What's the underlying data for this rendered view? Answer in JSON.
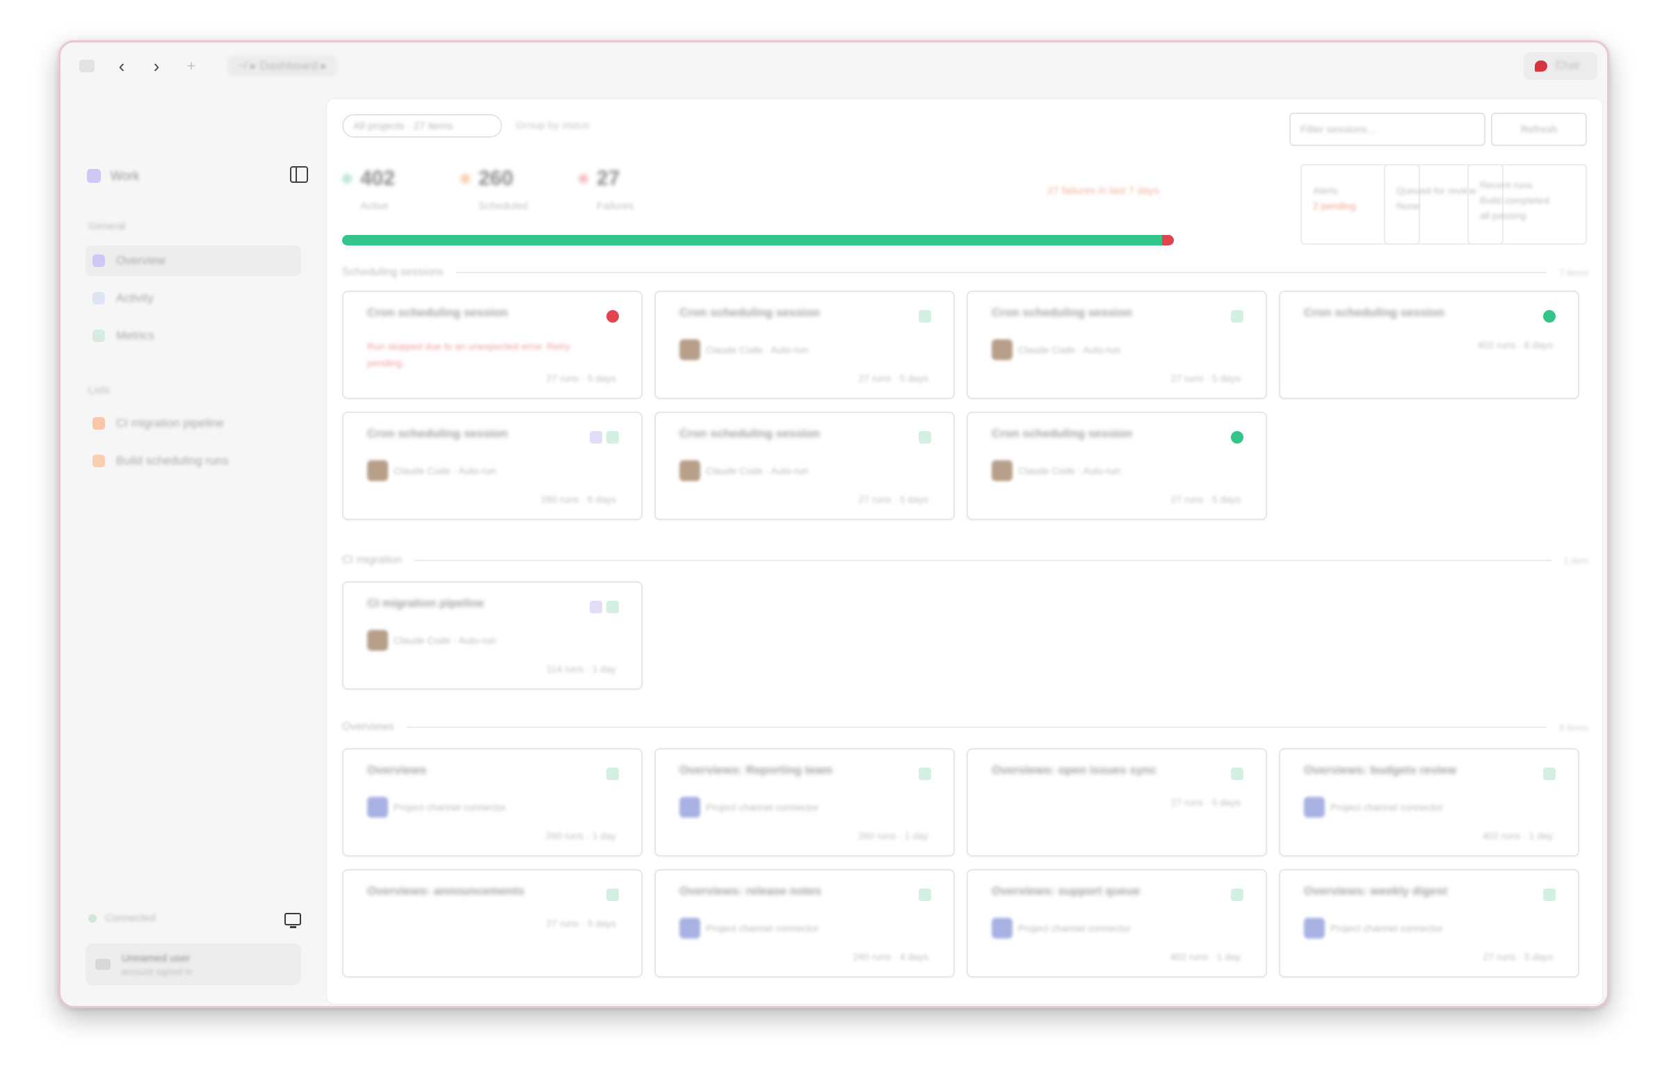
{
  "colors": {
    "accent_green": "#33c48a",
    "accent_red": "#e2434c",
    "accent_orange": "#f4a06a",
    "accent_purple": "#b9b0ef",
    "window_border": "#e9c8cd"
  },
  "titlebar": {
    "breadcrumb": "~/ ▸ Dashboard ▸",
    "chat_label": "Chat"
  },
  "sidebar": {
    "workspace": "Work",
    "section_main": "General",
    "items": [
      {
        "label": "Overview",
        "icon": "grid-icon",
        "color": "#cfc7f6",
        "active": true
      },
      {
        "label": "Activity",
        "icon": "activity-icon",
        "color": "#dde4f4",
        "active": false
      },
      {
        "label": "Metrics",
        "icon": "chart-icon",
        "color": "#d7ecdf",
        "active": false
      }
    ],
    "section_projects": "Lists",
    "projects": [
      {
        "label": "CI migration pipeline",
        "color": "#f9c7a8"
      },
      {
        "label": "Build scheduling runs",
        "color": "#f9cfb0"
      }
    ],
    "status": "Connected",
    "user_name": "Unnamed user",
    "user_email": "account signed in"
  },
  "toolbar": {
    "filter": "All projects · 27 items",
    "filter_extra": "Group by status",
    "search_placeholder": "Filter sessions...",
    "action_label": "Refresh"
  },
  "stats": [
    {
      "value": "402",
      "label": "Active",
      "color": "#bfe7d3"
    },
    {
      "value": "260",
      "label": "Scheduled",
      "color": "#f9d3b0"
    },
    {
      "value": "27",
      "label": "Failures",
      "color": "#f7c3c6"
    }
  ],
  "warning": "27 failures in last 7 days",
  "progress": {
    "ok_fraction": 0.986,
    "fail_fraction": 0.014
  },
  "mini_cards": [
    {
      "line1": "Alerts",
      "line2": "2 pending"
    },
    {
      "line1": "Queued for review",
      "line2": "None"
    },
    {
      "line1": "Recent runs",
      "line2": "Build completed",
      "line3": "all passing"
    }
  ],
  "groups": [
    {
      "title": "Scheduling sessions",
      "count": "7 items",
      "cards": [
        {
          "title": "Cron scheduling session",
          "status": "error",
          "alert": "Run stopped due to an unexpected error. Retry pending.",
          "foot": "27 runs · 5 days"
        },
        {
          "title": "Cron scheduling session",
          "status": "ok-square",
          "meta": "Claude Code · Auto-run",
          "foot": "27 runs · 5 days"
        },
        {
          "title": "Cron scheduling session",
          "status": "ok-square",
          "meta": "Claude Code · Auto-run",
          "foot": "27 runs · 5 days"
        },
        {
          "title": "Cron scheduling session",
          "status": "ok-dot",
          "meta": "",
          "foot": "402 runs · 6 days"
        },
        {
          "title": "Cron scheduling session",
          "status": "ok-pair",
          "meta": "Claude Code · Auto-run",
          "foot": "260 runs · 6 days"
        },
        {
          "title": "Cron scheduling session",
          "status": "ok-square",
          "meta": "Claude Code · Auto-run",
          "foot": "27 runs · 5 days"
        },
        {
          "title": "Cron scheduling session",
          "status": "ok-dot",
          "meta": "Claude Code · Auto-run",
          "foot": "27 runs · 5 days"
        }
      ]
    },
    {
      "title": "CI migration",
      "count": "1 item",
      "cards": [
        {
          "title": "CI migration pipeline",
          "status": "ok-pair",
          "meta": "Claude Code · Auto-run",
          "foot": "114 runs · 1 day"
        }
      ]
    },
    {
      "title": "Overviews",
      "count": "8 items",
      "cards": [
        {
          "title": "Overviews",
          "status": "ok-square",
          "meta": "Project channel connector",
          "foot": "260 runs · 1 day"
        },
        {
          "title": "Overviews: Reporting team",
          "status": "ok-square",
          "meta": "Project channel connector",
          "foot": "260 runs · 1 day"
        },
        {
          "title": "Overviews: open issues sync",
          "status": "ok-square",
          "meta": "",
          "foot": "27 runs · 5 days"
        },
        {
          "title": "Overviews: budgets review",
          "status": "ok-square",
          "meta": "Project channel connector",
          "foot": "402 runs · 1 day"
        },
        {
          "title": "Overviews: announcements",
          "status": "ok-square",
          "meta": "",
          "foot": "27 runs · 5 days"
        },
        {
          "title": "Overviews: release notes",
          "status": "ok-square",
          "meta": "Project channel connector",
          "foot": "260 runs · 4 days"
        },
        {
          "title": "Overviews: support queue",
          "status": "ok-square",
          "meta": "Project channel connector",
          "foot": "402 runs · 1 day"
        },
        {
          "title": "Overviews: weekly digest",
          "status": "ok-square",
          "meta": "Project channel connector",
          "foot": "27 runs · 5 days"
        }
      ]
    }
  ]
}
